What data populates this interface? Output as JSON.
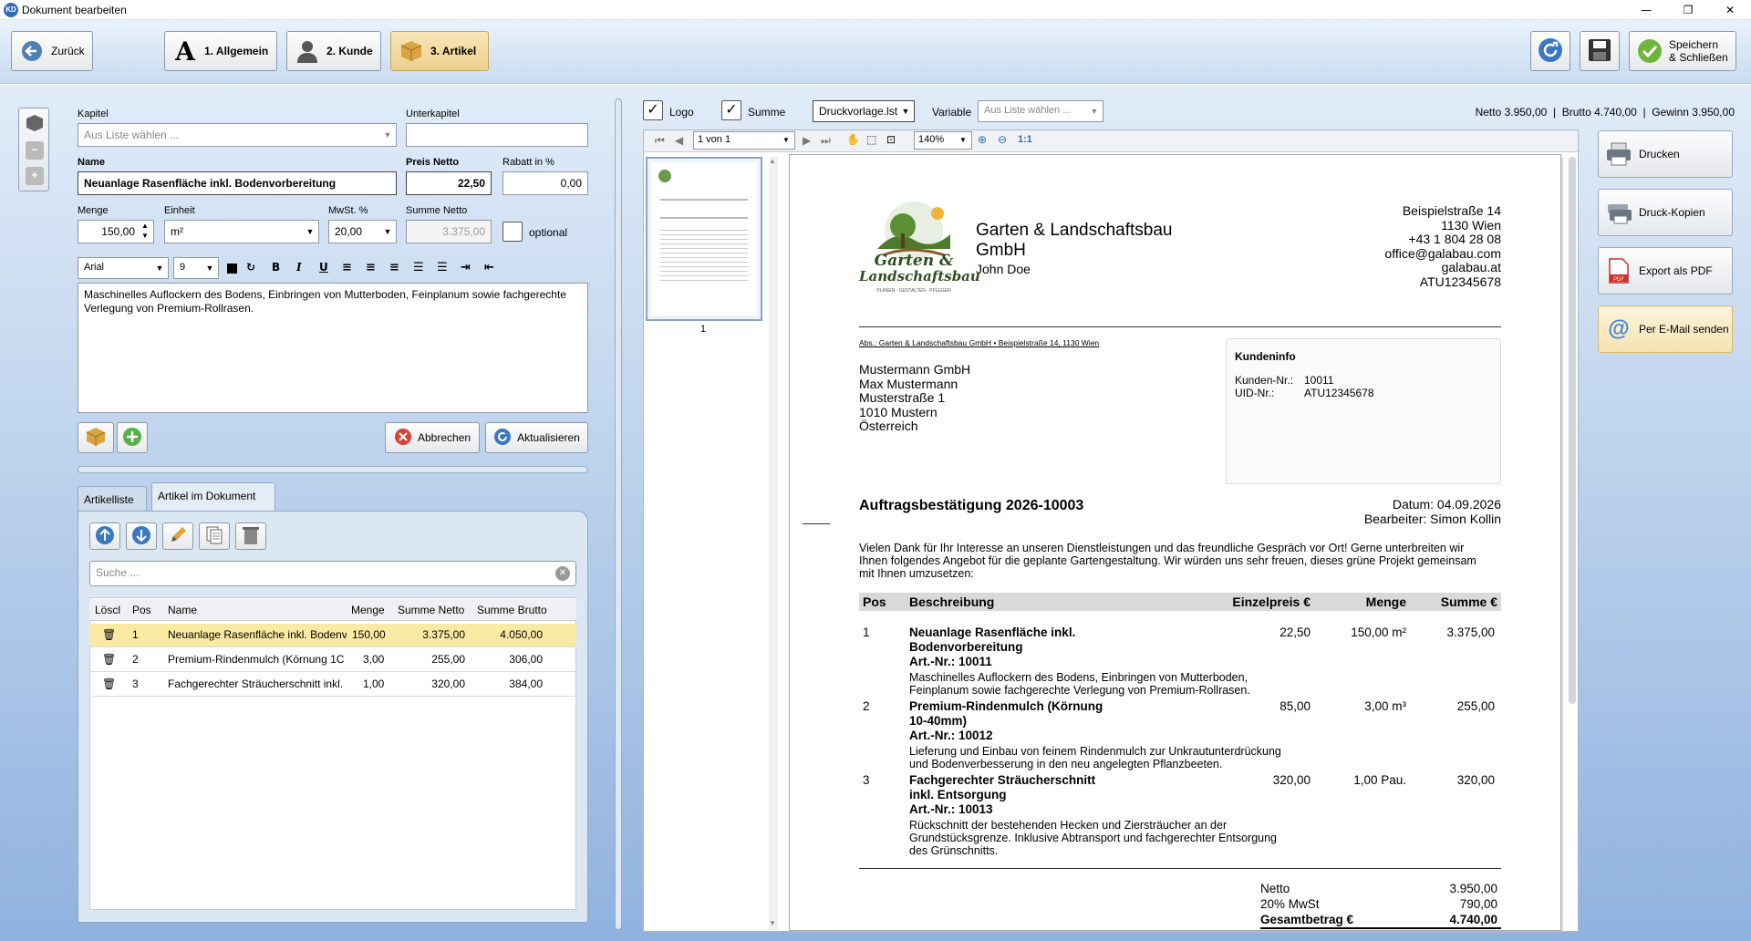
{
  "window": {
    "title": "Dokument bearbeiten",
    "icon": "KD"
  },
  "toolbar": {
    "back": "Zurück",
    "steps": [
      "1. Allgemein",
      "2. Kunde",
      "3. Artikel"
    ],
    "save_close_line1": "Speichern",
    "save_close_line2": "& Schließen"
  },
  "form": {
    "kapitel_label": "Kapitel",
    "kapitel_placeholder": "Aus Liste wählen ...",
    "unterkapitel_label": "Unterkapitel",
    "unterkapitel_value": "",
    "name_label": "Name",
    "name_value": "Neuanlage Rasenfläche inkl. Bodenvorbereitung",
    "preis_label": "Preis Netto",
    "preis_value": "22,50",
    "rabatt_label": "Rabatt in %",
    "rabatt_value": "0,00",
    "menge_label": "Menge",
    "menge_value": "150,00",
    "einheit_label": "Einheit",
    "einheit_value": "m²",
    "mwst_label": "MwSt. %",
    "mwst_value": "20,00",
    "summe_label": "Summe Netto",
    "summe_value": "3.375,00",
    "optional_label": "optional",
    "font_value": "Arial",
    "size_value": "9",
    "description": "Maschinelles Auflockern des Bodens, Einbringen von Mutterboden, Feinplanum sowie fachgerechte Verlegung von Premium-Rollrasen.",
    "cancel": "Abbrechen",
    "update": "Aktualisieren"
  },
  "tabs": [
    "Artikelliste",
    "Artikel im Dokument"
  ],
  "search_placeholder": "Suche ...",
  "grid": {
    "headers": [
      "Löscl",
      "Pos",
      "Name",
      "Menge",
      "Summe Netto",
      "Summe Brutto"
    ],
    "rows": [
      {
        "pos": "1",
        "name": "Neuanlage Rasenfläche inkl. Bodenv",
        "menge": "150,00",
        "netto": "3.375,00",
        "brutto": "4.050,00"
      },
      {
        "pos": "2",
        "name": "Premium-Rindenmulch (Körnung 1C",
        "menge": "3,00",
        "netto": "255,00",
        "brutto": "306,00"
      },
      {
        "pos": "3",
        "name": "Fachgerechter Sträucherschnitt inkl.",
        "menge": "1,00",
        "netto": "320,00",
        "brutto": "384,00"
      }
    ]
  },
  "preview_bar": {
    "logo_label": "Logo",
    "summe_label": "Summe",
    "template": "Druckvorlage.lst",
    "variable_label": "Variable",
    "variable_placeholder": "Aus Liste wählen ...",
    "totals": "Netto 3.950,00  |  Brutto 4.740,00  |  Gewinn 3.950,00",
    "page_value": "1 von 1",
    "zoom_value": "140%",
    "ratio": "1:1",
    "thumb_page": "1"
  },
  "actions": [
    "Drucken",
    "Druck-Kopien",
    "Export als PDF",
    "Per E-Mail senden"
  ],
  "document": {
    "company_line1": "Garten & Landschaftsbau",
    "company_line2": "GmbH",
    "contact": "John Doe",
    "logo_line1": "Garten &",
    "logo_line2": "Landschaftsbau",
    "logo_tagline": "PLANEN · GESTALTEN · PFLEGEN",
    "address": [
      "Beispielstraße 14",
      "1130 Wien",
      "+43 1 804 28 08",
      "office@galabau.com",
      "galabau.at",
      "ATU12345678"
    ],
    "sender_line": "Abs.: Garten & Landschaftsbau GmbH • Beispielstraße 14, 1130 Wien",
    "recipient": [
      "Mustermann GmbH",
      "Max Mustermann",
      "Musterstraße 1",
      "1010 Mustern",
      "Österreich"
    ],
    "kundeninfo_title": "Kundeninfo",
    "kunden_nr_label": "Kunden-Nr.:",
    "kunden_nr": "10011",
    "uid_label": "UID-Nr.:",
    "uid": "ATU12345678",
    "title": "Auftragsbestätigung 2026-10003",
    "datum": "Datum: 04.09.2026",
    "bearbeiter": "Bearbeiter: Simon Kollin",
    "intro": [
      "Vielen Dank für Ihr Interesse an unseren Dienstleistungen und das freundliche Gespräch vor Ort! Gerne unterbreiten wir",
      "Ihnen folgendes Angebot für die geplante Gartengestaltung. Wir würden uns sehr freuen, dieses grüne Projekt gemeinsam",
      "mit Ihnen umzusetzen:"
    ],
    "table_headers": [
      "Pos",
      "Beschreibung",
      "Einzelpreis €",
      "Menge",
      "Summe €"
    ],
    "items": [
      {
        "pos": "1",
        "title": [
          "Neuanlage Rasenfläche inkl.",
          "Bodenvorbereitung",
          "Art.-Nr.: 10011"
        ],
        "desc": [
          "Maschinelles Auflockern des Bodens, Einbringen von Mutterboden,",
          "Feinplanum sowie fachgerechte Verlegung von Premium-Rollrasen."
        ],
        "preis": "22,50",
        "menge": "150,00 m²",
        "summe": "3.375,00"
      },
      {
        "pos": "2",
        "title": [
          "Premium-Rindenmulch (Körnung",
          "10-40mm)",
          "Art.-Nr.: 10012"
        ],
        "desc": [
          "Lieferung und Einbau von feinem Rindenmulch zur Unkrautunterdrückung",
          "und Bodenverbesserung in den neu angelegten Pflanzbeeten."
        ],
        "preis": "85,00",
        "menge": "3,00 m³",
        "summe": "255,00"
      },
      {
        "pos": "3",
        "title": [
          "Fachgerechter Sträucherschnitt",
          "inkl. Entsorgung",
          "Art.-Nr.: 10013"
        ],
        "desc": [
          "Rückschnitt der bestehenden Hecken und Ziersträucher an der",
          "Grundstücksgrenze. Inklusive Abtransport und fachgerechter Entsorgung",
          "des Grünschnitts."
        ],
        "preis": "320,00",
        "menge": "1,00 Pau.",
        "summe": "320,00"
      }
    ],
    "netto_label": "Netto",
    "netto": "3.950,00",
    "mwst_label": "20% MwSt",
    "mwst": "790,00",
    "gesamt_label": "Gesamtbetrag €",
    "gesamt": "4.740,00"
  },
  "colors": {
    "accent": "#2e6eb5",
    "selected_row": "#fbeaa4",
    "active_step": "#edd08f"
  }
}
